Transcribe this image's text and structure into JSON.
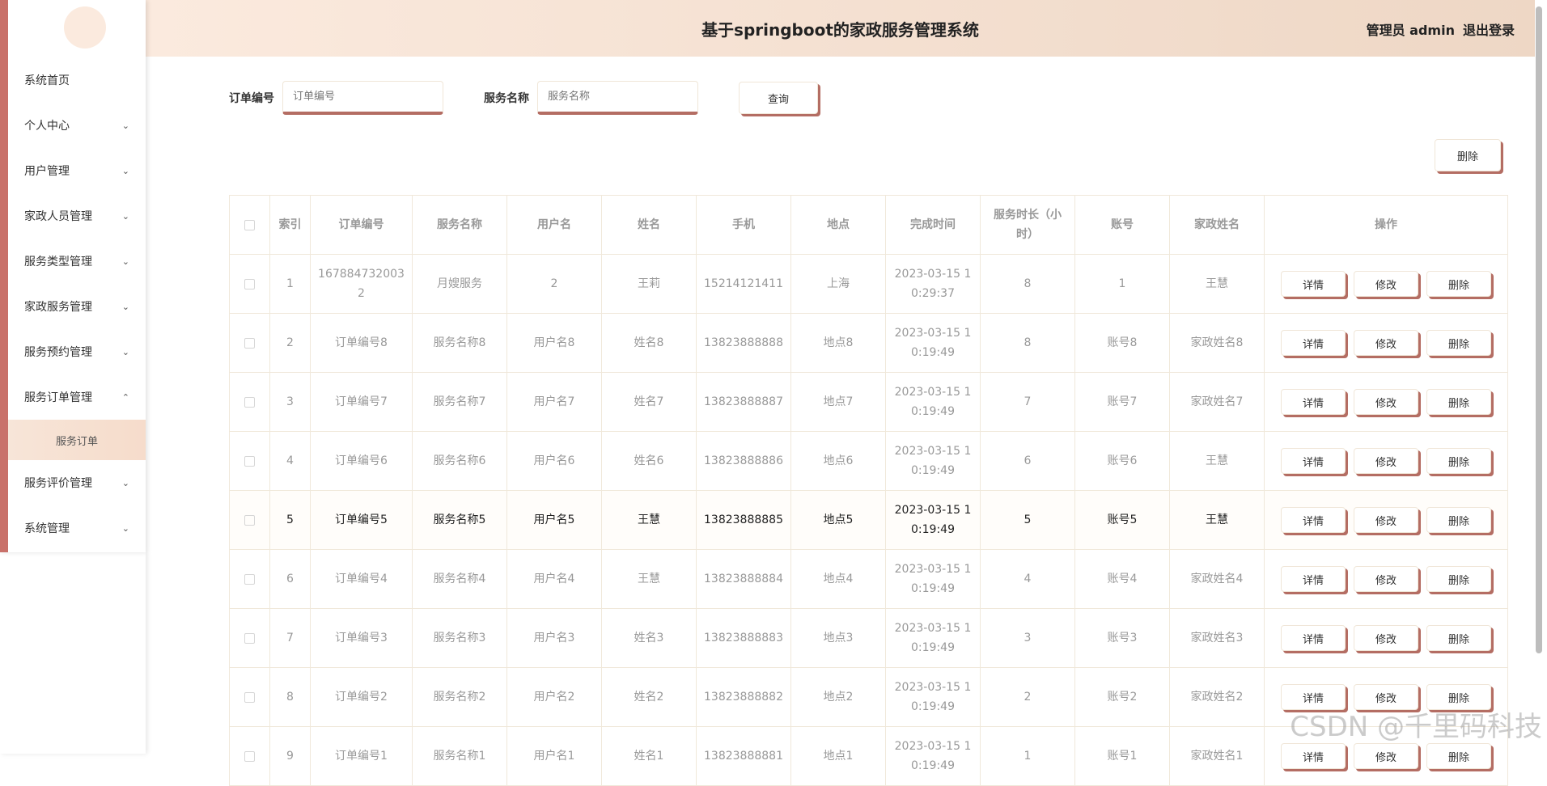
{
  "header": {
    "title": "基于springboot的家政服务管理系统",
    "user": "管理员 admin",
    "logout": "退出登录"
  },
  "sidebar": {
    "items": [
      {
        "label": "系统首页",
        "chevron": ""
      },
      {
        "label": "个人中心",
        "chevron": "⌄"
      },
      {
        "label": "用户管理",
        "chevron": "⌄"
      },
      {
        "label": "家政人员管理",
        "chevron": "⌄"
      },
      {
        "label": "服务类型管理",
        "chevron": "⌄"
      },
      {
        "label": "家政服务管理",
        "chevron": "⌄"
      },
      {
        "label": "服务预约管理",
        "chevron": "⌄"
      },
      {
        "label": "服务订单管理",
        "chevron": "⌃"
      },
      {
        "label": "服务评价管理",
        "chevron": "⌄"
      },
      {
        "label": "系统管理",
        "chevron": "⌄"
      }
    ],
    "subitem": "服务订单"
  },
  "search": {
    "order_label": "订单编号",
    "order_placeholder": "订单编号",
    "service_label": "服务名称",
    "service_placeholder": "服务名称",
    "query_button": "查询",
    "delete_button": "删除"
  },
  "table": {
    "headers": [
      "索引",
      "订单编号",
      "服务名称",
      "用户名",
      "姓名",
      "手机",
      "地点",
      "完成时间",
      "服务时长（小时）",
      "账号",
      "家政姓名",
      "操作"
    ],
    "ops": [
      "详情",
      "修改",
      "删除"
    ],
    "rows": [
      [
        "1",
        "1678847320032",
        "月嫂服务",
        "2",
        "王莉",
        "15214121411",
        "上海",
        "2023-03-15 10:29:37",
        "8",
        "1",
        "王慧"
      ],
      [
        "2",
        "订单编号8",
        "服务名称8",
        "用户名8",
        "姓名8",
        "13823888888",
        "地点8",
        "2023-03-15 10:19:49",
        "8",
        "账号8",
        "家政姓名8"
      ],
      [
        "3",
        "订单编号7",
        "服务名称7",
        "用户名7",
        "姓名7",
        "13823888887",
        "地点7",
        "2023-03-15 10:19:49",
        "7",
        "账号7",
        "家政姓名7"
      ],
      [
        "4",
        "订单编号6",
        "服务名称6",
        "用户名6",
        "姓名6",
        "13823888886",
        "地点6",
        "2023-03-15 10:19:49",
        "6",
        "账号6",
        "王慧"
      ],
      [
        "5",
        "订单编号5",
        "服务名称5",
        "用户名5",
        "王慧",
        "13823888885",
        "地点5",
        "2023-03-15 10:19:49",
        "5",
        "账号5",
        "王慧"
      ],
      [
        "6",
        "订单编号4",
        "服务名称4",
        "用户名4",
        "王慧",
        "13823888884",
        "地点4",
        "2023-03-15 10:19:49",
        "4",
        "账号4",
        "家政姓名4"
      ],
      [
        "7",
        "订单编号3",
        "服务名称3",
        "用户名3",
        "姓名3",
        "13823888883",
        "地点3",
        "2023-03-15 10:19:49",
        "3",
        "账号3",
        "家政姓名3"
      ],
      [
        "8",
        "订单编号2",
        "服务名称2",
        "用户名2",
        "姓名2",
        "13823888882",
        "地点2",
        "2023-03-15 10:19:49",
        "2",
        "账号2",
        "家政姓名2"
      ],
      [
        "9",
        "订单编号1",
        "服务名称1",
        "用户名1",
        "姓名1",
        "13823888881",
        "地点1",
        "2023-03-15 10:19:49",
        "1",
        "账号1",
        "家政姓名1"
      ]
    ],
    "highlight_row": 4
  },
  "watermark": "CSDN @千里码科技"
}
